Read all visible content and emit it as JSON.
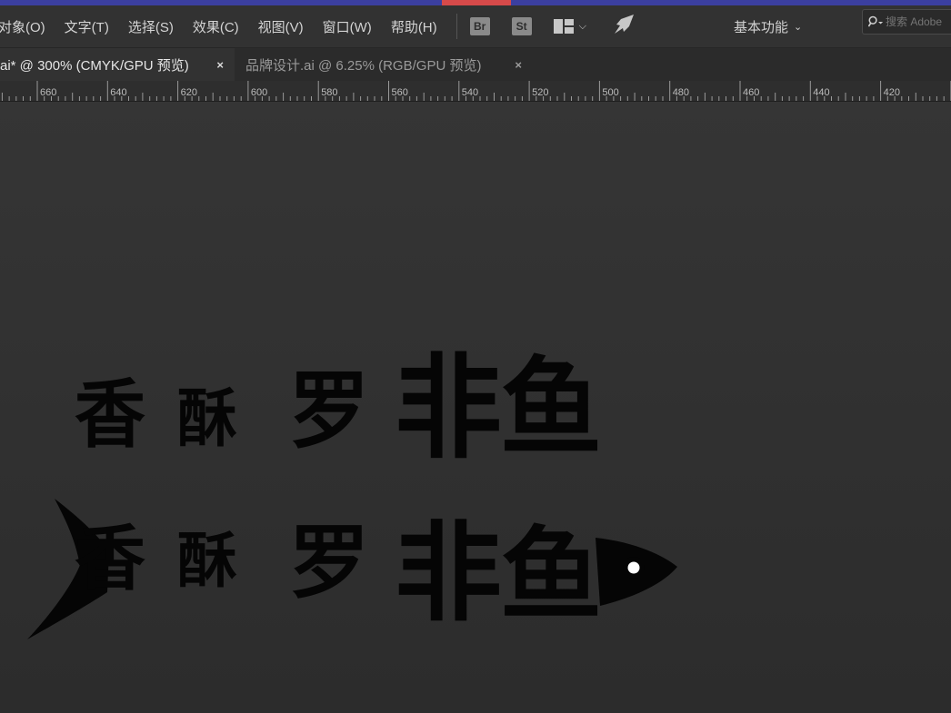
{
  "menubar": {
    "items": [
      "对象(O)",
      "文字(T)",
      "选择(S)",
      "效果(C)",
      "视图(V)",
      "窗口(W)",
      "帮助(H)"
    ],
    "bridge_label": "Br",
    "stock_label": "St",
    "workspace_label": "基本功能",
    "search_placeholder": "搜索 Adobe"
  },
  "tabs": [
    {
      "label": "ai* @ 300% (CMYK/GPU 预览)",
      "close": "×"
    },
    {
      "label": "品牌设计.ai @ 6.25% (RGB/GPU 预览)",
      "close": "×"
    }
  ],
  "ruler": {
    "labels": [
      "660",
      "640",
      "620",
      "600",
      "580",
      "560",
      "540",
      "520",
      "500",
      "480",
      "460",
      "440",
      "420"
    ]
  },
  "artwork": {
    "logo_text": [
      "香",
      "酥",
      "罗",
      "非",
      "鱼"
    ],
    "fill_color": "#050505",
    "eye_color": "#ffffff"
  }
}
